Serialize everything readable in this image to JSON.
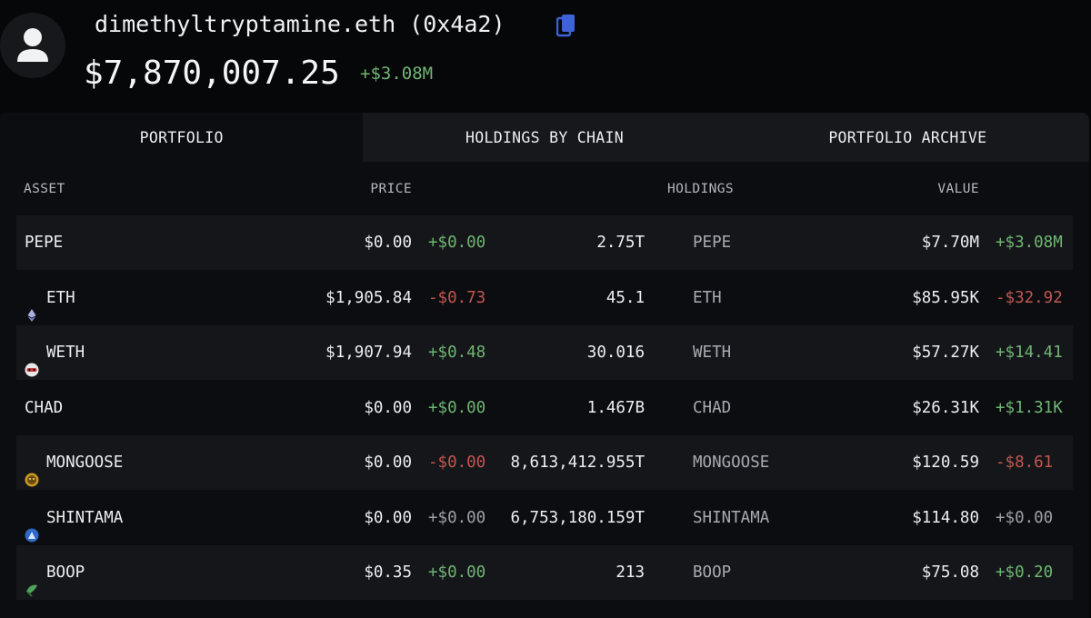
{
  "header": {
    "wallet_name": "dimethyltryptamine.eth (0x4a2)",
    "total_value": "$7,870,007.25",
    "total_change": "+$3.08M",
    "icons": {
      "avatar": "user-avatar-icon",
      "copy": "copy-icon"
    }
  },
  "tabs": [
    {
      "label": "PORTFOLIO",
      "active": true
    },
    {
      "label": "HOLDINGS BY CHAIN",
      "active": false
    },
    {
      "label": "PORTFOLIO ARCHIVE",
      "active": false
    }
  ],
  "table": {
    "columns": [
      "ASSET",
      "PRICE",
      "HOLDINGS",
      "VALUE"
    ],
    "rows": [
      {
        "asset": "PEPE",
        "icon": "none",
        "price": "$0.00",
        "price_change": "+$0.00",
        "price_trend": "pos",
        "holdings": "2.75T",
        "holdings_symbol": "PEPE",
        "value": "$7.70M",
        "value_change": "+$3.08M",
        "value_trend": "pos"
      },
      {
        "asset": "ETH",
        "icon": "eth-icon",
        "price": "$1,905.84",
        "price_change": "-$0.73",
        "price_trend": "neg",
        "holdings": "45.1",
        "holdings_symbol": "ETH",
        "value": "$85.95K",
        "value_change": "-$32.92",
        "value_trend": "neg"
      },
      {
        "asset": "WETH",
        "icon": "weth-icon",
        "price": "$1,907.94",
        "price_change": "+$0.48",
        "price_trend": "pos",
        "holdings": "30.016",
        "holdings_symbol": "WETH",
        "value": "$57.27K",
        "value_change": "+$14.41",
        "value_trend": "pos"
      },
      {
        "asset": "CHAD",
        "icon": "none",
        "price": "$0.00",
        "price_change": "+$0.00",
        "price_trend": "pos",
        "holdings": "1.467B",
        "holdings_symbol": "CHAD",
        "value": "$26.31K",
        "value_change": "+$1.31K",
        "value_trend": "pos"
      },
      {
        "asset": "MONGOOSE",
        "icon": "mongoose-icon",
        "price": "$0.00",
        "price_change": "-$0.00",
        "price_trend": "neg",
        "holdings": "8,613,412.955T",
        "holdings_symbol": "MONGOOSE",
        "value": "$120.59",
        "value_change": "-$8.61",
        "value_trend": "neg"
      },
      {
        "asset": "SHINTAMA",
        "icon": "shintama-icon",
        "price": "$0.00",
        "price_change": "+$0.00",
        "price_trend": "neu",
        "holdings": "6,753,180.159T",
        "holdings_symbol": "SHINTAMA",
        "value": "$114.80",
        "value_change": "+$0.00",
        "value_trend": "neu"
      },
      {
        "asset": "BOOP",
        "icon": "boop-icon",
        "price": "$0.35",
        "price_change": "+$0.00",
        "price_trend": "pos",
        "holdings": "213",
        "holdings_symbol": "BOOP",
        "value": "$75.08",
        "value_change": "+$0.20",
        "value_trend": "pos"
      }
    ]
  },
  "colors": {
    "background": "#060709",
    "panel": "#0c0d10",
    "row_shade": "#15161a",
    "positive": "#6fb572",
    "negative": "#c2564f",
    "neutral": "#9da0a6",
    "copy_icon": "#3e63d6"
  }
}
